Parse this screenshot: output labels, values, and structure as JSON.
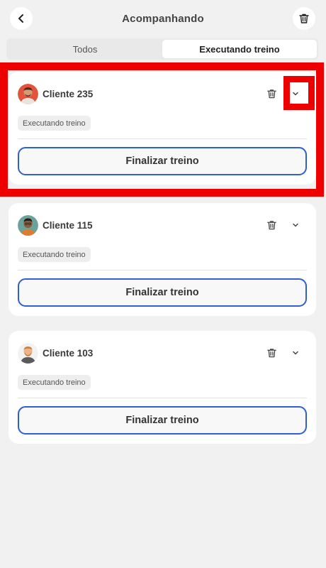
{
  "header": {
    "title": "Acompanhando",
    "back_icon": "chevron-left-icon",
    "delete_all_icon": "trash-icon"
  },
  "tabs": [
    {
      "label": "Todos",
      "active": false
    },
    {
      "label": "Executando treino",
      "active": true
    }
  ],
  "cards": [
    {
      "name": "Cliente 235",
      "status": "Executando treino",
      "button": "Finalizar treino",
      "avatar": "avatar-red-shirt"
    },
    {
      "name": "Cliente 115",
      "status": "Executando treino",
      "button": "Finalizar treino",
      "avatar": "avatar-green"
    },
    {
      "name": "Cliente 103",
      "status": "Executando treino",
      "button": "Finalizar treino",
      "avatar": "avatar-beard"
    }
  ],
  "colors": {
    "accent": "#2f5fd0",
    "highlight": "#ee0000",
    "background": "#f1f1f1"
  }
}
